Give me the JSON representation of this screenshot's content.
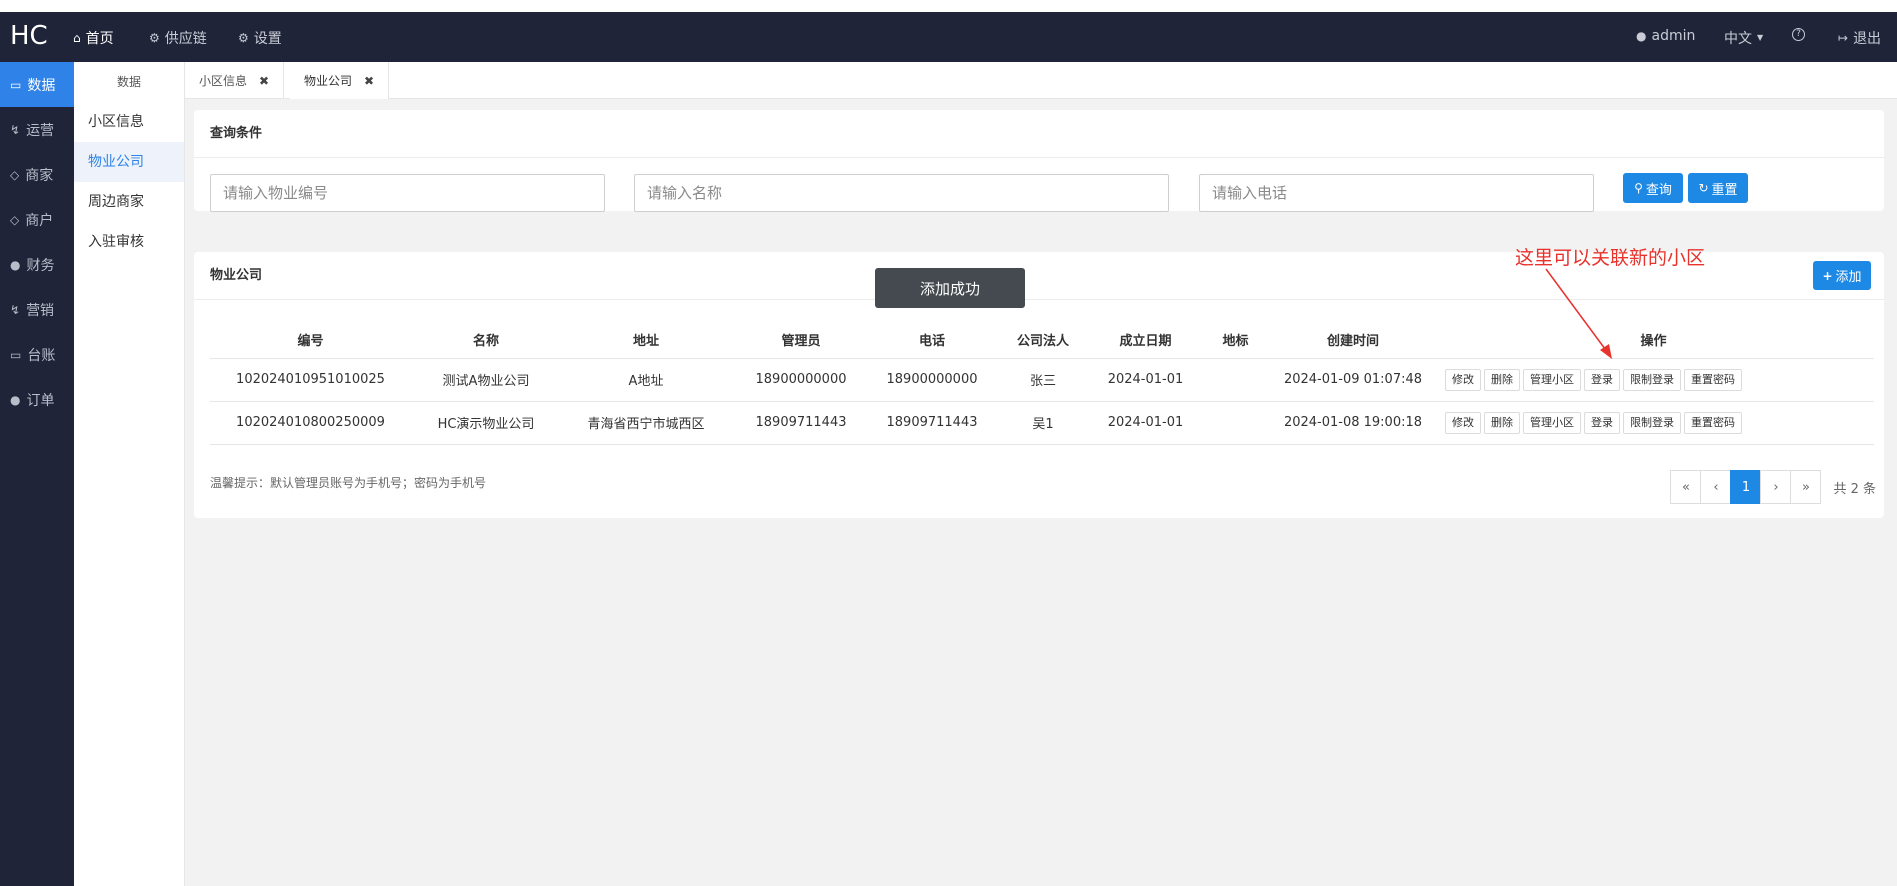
{
  "app": {
    "logo": "HC",
    "top_nav": [
      {
        "label": "首页",
        "icon": "home-icon"
      },
      {
        "label": "供应链",
        "icon": "gear-icon"
      },
      {
        "label": "设置",
        "icon": "gear-icon"
      }
    ],
    "user": "admin",
    "language": "中文",
    "help_icon": "question-circle-icon",
    "logout": "退出"
  },
  "left_nav": [
    {
      "label": "数据",
      "icon": "monitor-icon"
    },
    {
      "label": "运营",
      "icon": "bolt-icon"
    },
    {
      "label": "商家",
      "icon": "diamond-icon"
    },
    {
      "label": "商户",
      "icon": "diamond-icon"
    },
    {
      "label": "财务",
      "icon": "globe-icon"
    },
    {
      "label": "营销",
      "icon": "bolt-icon"
    },
    {
      "label": "台账",
      "icon": "monitor-icon"
    },
    {
      "label": "订单",
      "icon": "globe-icon"
    }
  ],
  "sub_nav": {
    "title": "数据",
    "items": [
      "小区信息",
      "物业公司",
      "周边商家",
      "入驻审核"
    ]
  },
  "tabs": [
    {
      "label": "小区信息",
      "close": "✖"
    },
    {
      "label": "物业公司",
      "close": "✖"
    }
  ],
  "search": {
    "title": "查询条件",
    "code_placeholder": "请输入物业编号",
    "name_placeholder": "请输入名称",
    "phone_placeholder": "请输入电话",
    "query_label": "查询",
    "reset_label": "重置"
  },
  "list": {
    "title": "物业公司",
    "add_label": "添加",
    "columns": [
      "编号",
      "名称",
      "地址",
      "管理员",
      "电话",
      "公司法人",
      "成立日期",
      "地标",
      "创建时间",
      "操作"
    ],
    "rows": [
      {
        "code": "102024010951010025",
        "name": "测试A物业公司",
        "address": "A地址",
        "admin": "18900000000",
        "phone": "18900000000",
        "legal": "张三",
        "founded": "2024-01-01",
        "landmark": "",
        "created": "2024-01-09 01:07:48"
      },
      {
        "code": "102024010800250009",
        "name": "HC演示物业公司",
        "address": "青海省西宁市城西区",
        "admin": "18909711443",
        "phone": "18909711443",
        "legal": "吴1",
        "founded": "2024-01-01",
        "landmark": "",
        "created": "2024-01-08 19:00:18"
      }
    ],
    "actions": [
      "修改",
      "删除",
      "管理小区",
      "登录",
      "限制登录",
      "重置密码"
    ],
    "tip": "温馨提示：默认管理员账号为手机号；密码为手机号",
    "pagination": {
      "first": "«",
      "prev": "‹",
      "current": "1",
      "next": "›",
      "last": "»",
      "total": "共 2 条"
    }
  },
  "toast": "添加成功",
  "annotation": "这里可以关联新的小区",
  "colors": {
    "sidebar_bg": "#1f2438",
    "accent": "#1e88e5",
    "annotation": "#e8322c"
  }
}
